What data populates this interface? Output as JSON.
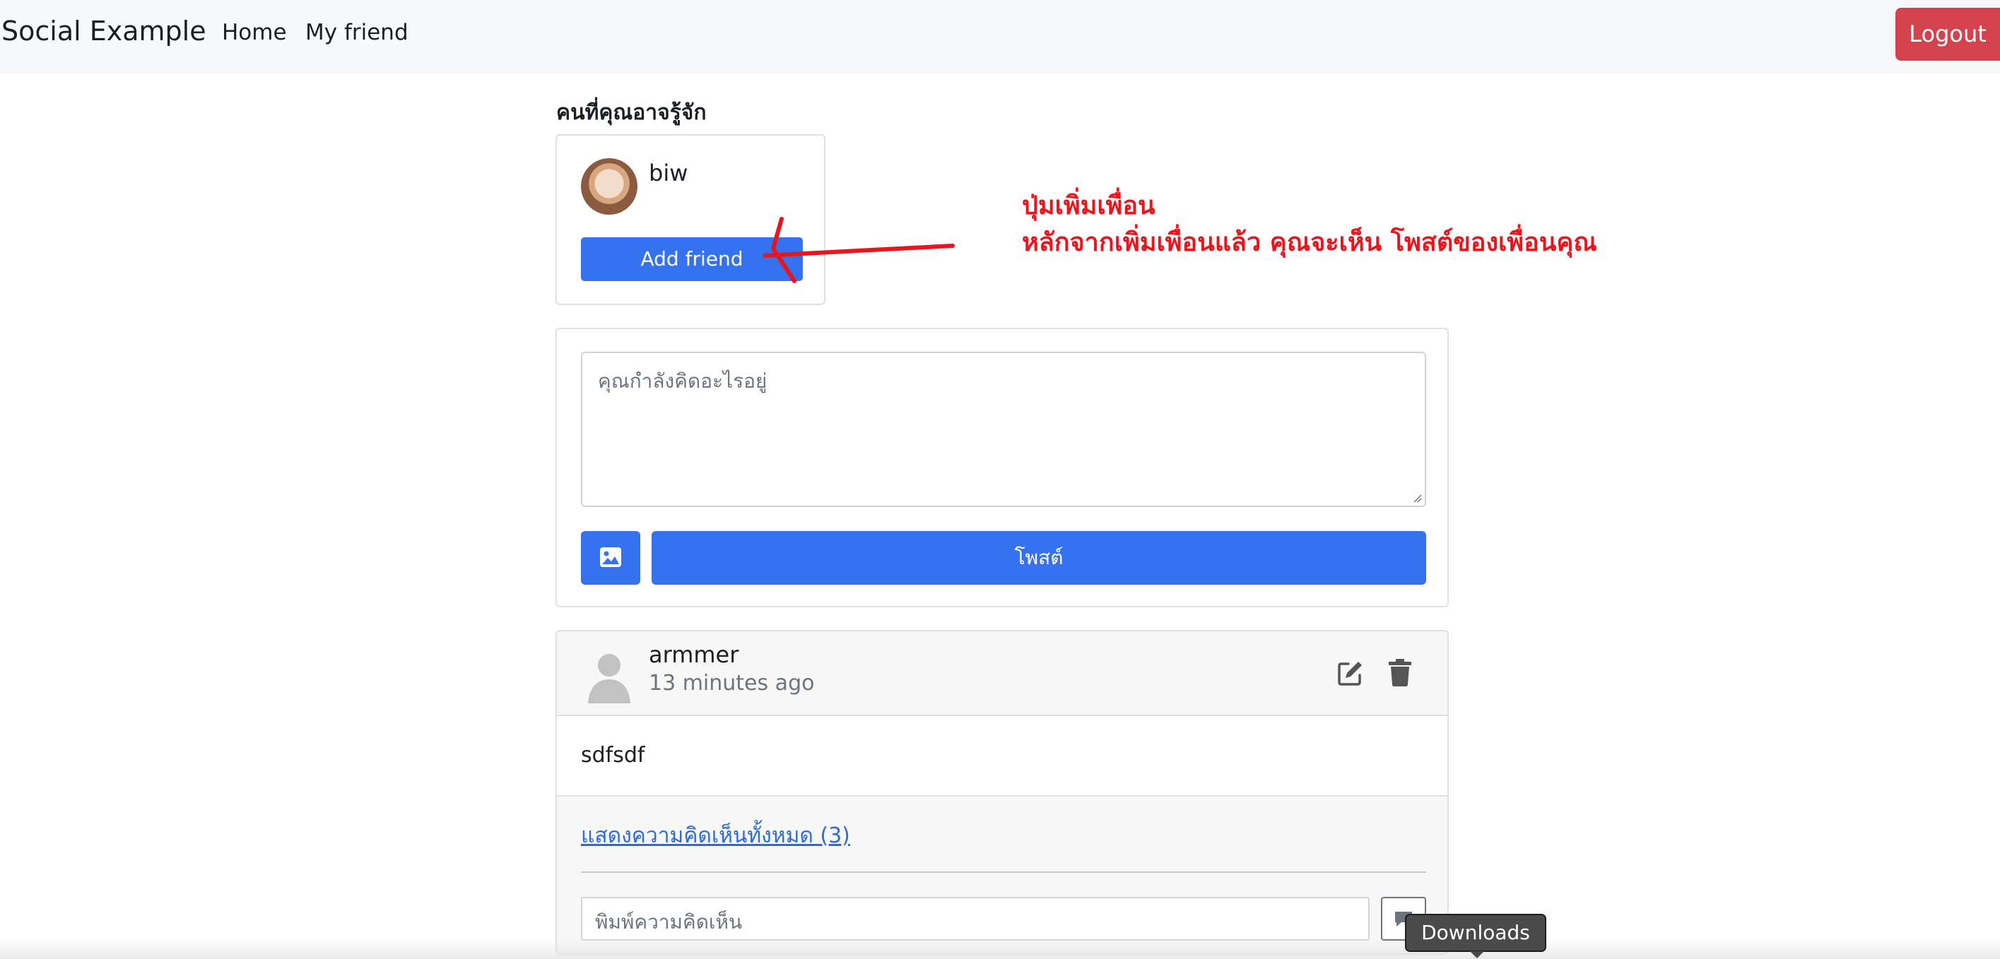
{
  "navbar": {
    "brand": "Social Example",
    "links": [
      "Home",
      "My friend"
    ],
    "logout": "Logout"
  },
  "suggestions": {
    "title": "คนที่คุณอาจรู้จัก",
    "friend": {
      "name": "biw",
      "button": "Add friend"
    }
  },
  "annotation": {
    "line1": "ปุ่มเพิ่มเพื่อน",
    "line2": "หลักจากเพิ่มเพื่อนแล้ว คุณจะเห็น โพสต์ของเพื่อนคุณ",
    "color": "#e8151c"
  },
  "composer": {
    "placeholder": "คุณกำลังคิดอะไรอยู่",
    "image_icon": "image-icon",
    "post_button": "โพสต์"
  },
  "post": {
    "author": "armmer",
    "time": "13 minutes ago",
    "body": "sdfsdf",
    "show_comments": "แสดงความคิดเห็นทั้งหมด (3)",
    "comment_placeholder": "พิมพ์ความคิดเห็น",
    "icons": [
      "edit-icon",
      "trash-icon",
      "comment-send-icon"
    ]
  },
  "tooltip": {
    "downloads": "Downloads"
  },
  "colors": {
    "primary": "#3472f0",
    "danger": "#d3434d",
    "link": "#2f6bd6"
  }
}
